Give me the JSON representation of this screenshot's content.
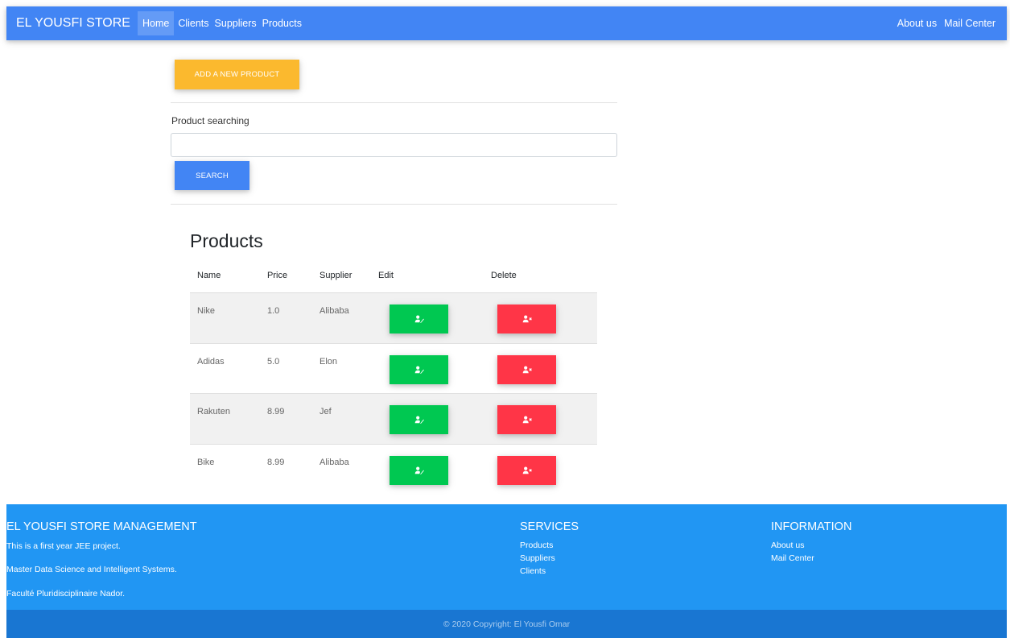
{
  "navbar": {
    "brand": "EL YOUSFI STORE",
    "links": [
      "Home",
      "Clients",
      "Suppliers",
      "Products"
    ],
    "right_links": [
      "About us",
      "Mail Center"
    ]
  },
  "actions": {
    "add_label": "ADD A NEW PRODUCT",
    "search_label": "Product searching",
    "search_value": "",
    "search_button": "SEARCH"
  },
  "products": {
    "title": "Products",
    "columns": [
      "Name",
      "Price",
      "Supplier",
      "Edit",
      "Delete"
    ],
    "rows": [
      {
        "name": "Nike",
        "price": "1.0",
        "supplier": "Alibaba"
      },
      {
        "name": "Adidas",
        "price": "5.0",
        "supplier": "Elon"
      },
      {
        "name": "Rakuten",
        "price": "8.99",
        "supplier": "Jef"
      },
      {
        "name": "Bike",
        "price": "8.99",
        "supplier": "Alibaba"
      }
    ],
    "edit_icon": "user-edit-icon",
    "delete_icon": "user-times-icon"
  },
  "footer": {
    "title": "EL YOUSFI STORE MANAGEMENT",
    "lines": [
      "This is a first year JEE project.",
      "Master Data Science and Intelligent Systems.",
      "Faculté Pluridisciplinaire Nador."
    ],
    "services_title": "SERVICES",
    "services": [
      "Products",
      "Suppliers",
      "Clients"
    ],
    "info_title": "INFORMATION",
    "info": [
      "About us",
      "Mail Center"
    ],
    "copyright": "© 2020 Copyright: El Yousfi Omar"
  },
  "colors": {
    "navbar": "#4285f4",
    "add_button": "#fbb92e",
    "search_button": "#4285f4",
    "edit_button": "#00c851",
    "delete_button": "#ff3547",
    "footer": "#2196f3",
    "copyright_bar": "#1976d2"
  }
}
